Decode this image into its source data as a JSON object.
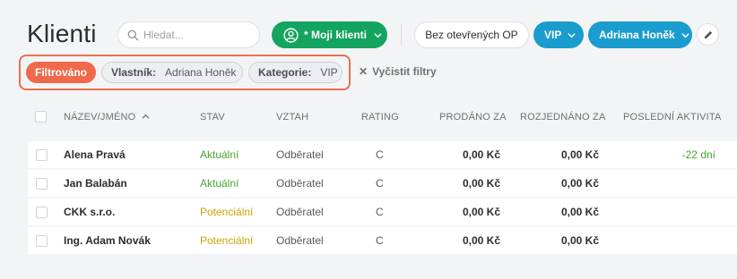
{
  "header": {
    "title": "Klienti",
    "search_placeholder": "Hledat...",
    "my_clients_label": "* Moji klienti",
    "no_open_label": "Bez otevřených OP",
    "vip_label": "VIP",
    "owner_label": "Adriana Honěk"
  },
  "filters": {
    "active_label": "Filtrováno",
    "owner_key": "Vlastník:",
    "owner_value": "Adriana Honěk",
    "category_key": "Kategorie:",
    "category_value": "VIP",
    "clear_label": "Vyčistit filtry"
  },
  "table": {
    "columns": {
      "name": "NÁZEV/JMÉNO",
      "status": "STAV",
      "relation": "VZTAH",
      "rating": "RATING",
      "sold": "PRODÁNO ZA",
      "negotiated": "ROZJEDNÁNO ZA",
      "last_activity": "POSLEDNÍ AKTIVITA"
    },
    "rows": [
      {
        "name": "Alena Pravá",
        "status": "Aktuální",
        "relation": "Odběratel",
        "rating": "C",
        "sold": "0,00 Kč",
        "negotiated": "0,00 Kč",
        "last_activity": "-22 dní"
      },
      {
        "name": "Jan Balabán",
        "status": "Aktuální",
        "relation": "Odběratel",
        "rating": "C",
        "sold": "0,00 Kč",
        "negotiated": "0,00 Kč",
        "last_activity": ""
      },
      {
        "name": "CKK s.r.o.",
        "status": "Potenciální",
        "relation": "Odběratel",
        "rating": "C",
        "sold": "0,00 Kč",
        "negotiated": "0,00 Kč",
        "last_activity": ""
      },
      {
        "name": "Ing. Adam Novák",
        "status": "Potenciální",
        "relation": "Odběratel",
        "rating": "C",
        "sold": "0,00 Kč",
        "negotiated": "0,00 Kč",
        "last_activity": ""
      }
    ]
  },
  "colors": {
    "status_current": "#4aa52e",
    "status_potential": "#c9a400",
    "green_button": "#13a45f",
    "blue_button": "#1a9ccf",
    "filter_accent": "#ee6a4b"
  }
}
